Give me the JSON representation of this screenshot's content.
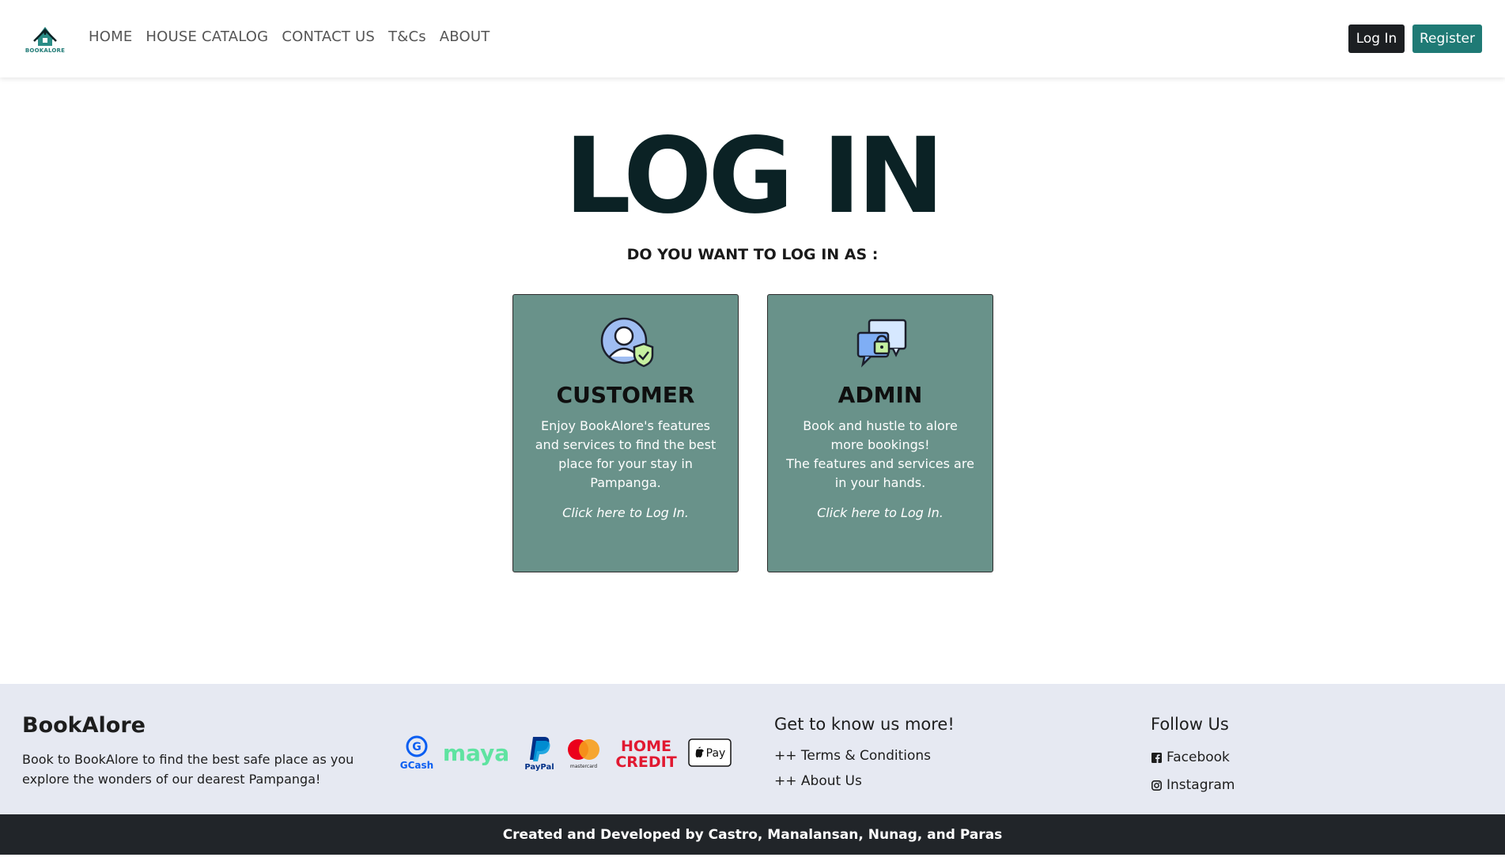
{
  "navbar": {
    "logo_text": "BOOKALORE",
    "links": [
      "HOME",
      "HOUSE CATALOG",
      "CONTACT US",
      "T&Cs",
      "ABOUT"
    ],
    "login_label": "Log In",
    "register_label": "Register"
  },
  "main": {
    "title": "LOG IN",
    "subtitle": "DO YOU WANT TO LOG IN AS :",
    "cards": [
      {
        "icon": "user-shield-icon",
        "title": "CUSTOMER",
        "description": "Enjoy BookAlore's features and services to find the best place for your stay in Pampanga.",
        "link": "Click here to Log In."
      },
      {
        "icon": "chat-lock-icon",
        "title": "ADMIN",
        "description": "Book and hustle to alore more bookings!\nThe features and services are in your hands.",
        "link": "Click here to Log In."
      }
    ]
  },
  "footer": {
    "brand": "BookAlore",
    "description": "Book to BookAlore to find the best safe place as you explore the wonders of our dearest Pampanga!",
    "payments": {
      "gcash": "GCash",
      "maya": "maya",
      "paypal": "PayPal",
      "mastercard": "mastercard",
      "homecredit_line1": "HOME",
      "homecredit_line2": "CREDIT",
      "applepay": "Pay"
    },
    "more_heading": "Get to know us more!",
    "links": [
      "++ Terms & Conditions",
      "++ About Us"
    ],
    "follow_heading": "Follow Us",
    "social": [
      "Facebook",
      "Instagram"
    ],
    "credits": "Created and Developed by Castro, Manalansan, Nunag, and Paras"
  },
  "colors": {
    "accent": "#1f7a75",
    "card_bg": "#69928a",
    "title": "#0b2225",
    "footer_bg": "#e6e9f2",
    "bottom_bar": "#212529"
  }
}
